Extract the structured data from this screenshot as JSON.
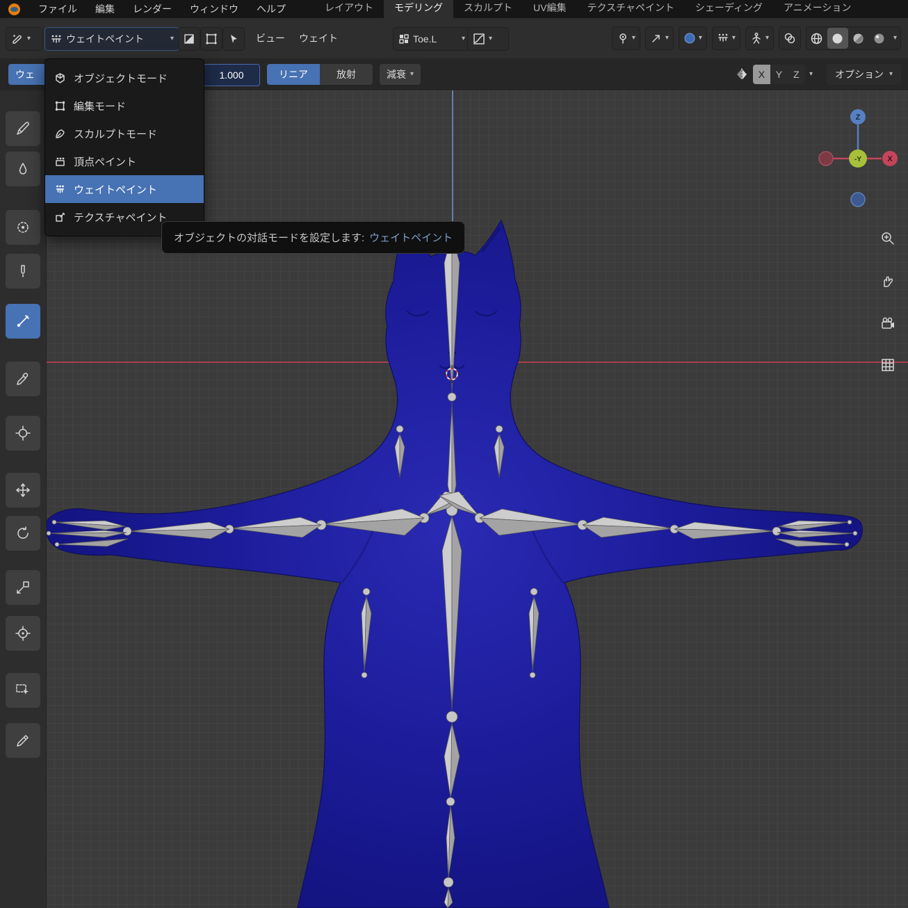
{
  "topbar": {
    "menus": [
      "ファイル",
      "編集",
      "レンダー",
      "ウィンドウ",
      "ヘルプ"
    ],
    "tabs": [
      "レイアウト",
      "モデリング",
      "スカルプト",
      "UV編集",
      "テクスチャペイント",
      "シェーディング",
      "アニメーション"
    ],
    "active_tab": "モデリング"
  },
  "header": {
    "mode_button": "ウェイトペイント",
    "view_menu": "ビュー",
    "weight_menu": "ウェイト",
    "bone_field": "Toe.L"
  },
  "toolsettings": {
    "weight_fragment": "ウェ",
    "strength_value": "1.000",
    "linear": "リニア",
    "radial": "放射",
    "falloff": "減衰",
    "mirror": {
      "x": "X",
      "y": "Y",
      "z": "Z"
    },
    "options": "オプション"
  },
  "mode_menu": {
    "items": [
      {
        "label": "オブジェクトモード"
      },
      {
        "label": "編集モード"
      },
      {
        "label": "スカルプトモード"
      },
      {
        "label": "頂点ペイント"
      },
      {
        "label": "ウェイトペイント"
      },
      {
        "label": "テクスチャペイント"
      }
    ],
    "selected": "ウェイトペイント"
  },
  "tooltip": {
    "text": "オブジェクトの対話モードを設定します:",
    "value": "ウェイトペイント"
  },
  "viewport": {
    "gizmo": {
      "z": "Z",
      "x": "X",
      "front": "-Y"
    }
  },
  "colors": {
    "accent": "#4772b3",
    "model_blue": "#1d1d9e",
    "axis_x": "#a8404f",
    "axis_z": "#6483ad"
  }
}
